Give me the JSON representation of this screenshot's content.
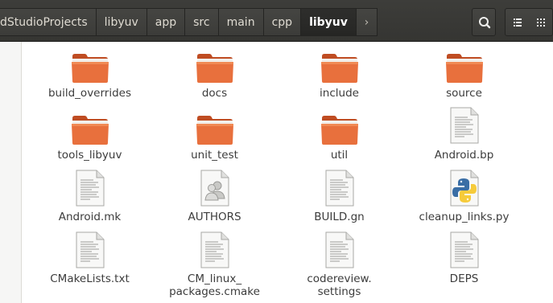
{
  "breadcrumbs": [
    {
      "label": "dStudioProjects"
    },
    {
      "label": "libyuv"
    },
    {
      "label": "app"
    },
    {
      "label": "src"
    },
    {
      "label": "main"
    },
    {
      "label": "cpp"
    },
    {
      "label": "libyuv",
      "active": true
    }
  ],
  "header": {
    "next_icon": "chevron-right-icon",
    "search_icon": "search-icon",
    "list_icon": "list-view-icon",
    "grid_icon": "grid-view-icon"
  },
  "colors": {
    "folder": "#e8703d",
    "headerbar": "#3a3a37",
    "active_crumb": "#2a2a28"
  },
  "files": [
    {
      "name": "build_overrides",
      "type": "folder"
    },
    {
      "name": "docs",
      "type": "folder"
    },
    {
      "name": "include",
      "type": "folder"
    },
    {
      "name": "source",
      "type": "folder"
    },
    {
      "name": "tools_libyuv",
      "type": "folder"
    },
    {
      "name": "unit_test",
      "type": "folder"
    },
    {
      "name": "util",
      "type": "folder"
    },
    {
      "name": "Android.bp",
      "type": "text"
    },
    {
      "name": "Android.mk",
      "type": "text"
    },
    {
      "name": "AUTHORS",
      "type": "contact"
    },
    {
      "name": "BUILD.gn",
      "type": "text"
    },
    {
      "name": "cleanup_links.py",
      "type": "python"
    },
    {
      "name": "CMakeLists.txt",
      "type": "text"
    },
    {
      "name": "CM_linux_\npackages.cmake",
      "type": "text"
    },
    {
      "name": "codereview.\nsettings",
      "type": "text"
    },
    {
      "name": "DEPS",
      "type": "text"
    }
  ]
}
